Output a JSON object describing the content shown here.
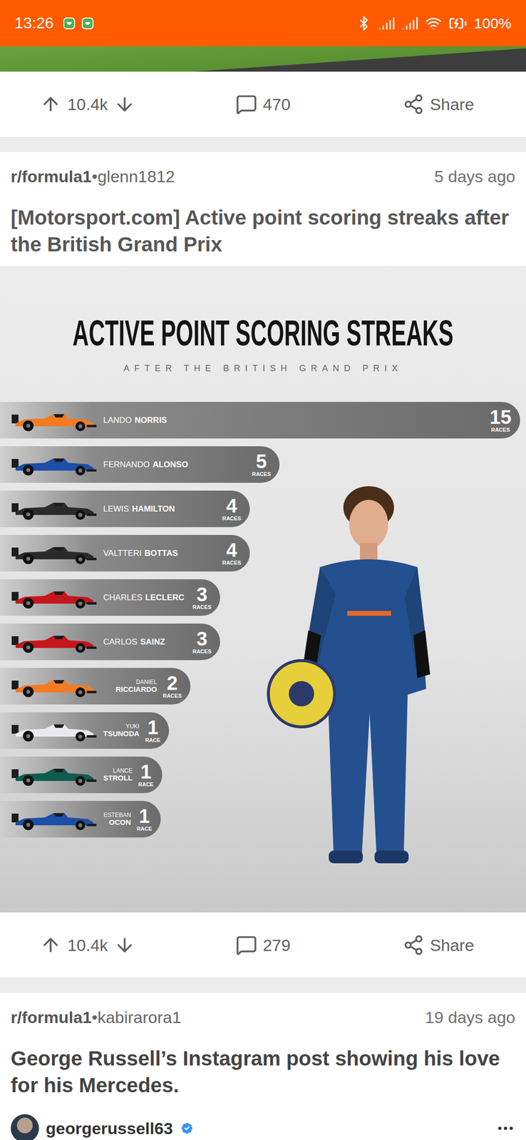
{
  "status_bar": {
    "time": "13:26",
    "battery": "100%",
    "charging": true
  },
  "feed": {
    "previous_post": {
      "actions": {
        "votes": "10.4k",
        "comments": "470",
        "share": "Share"
      }
    },
    "posts": [
      {
        "kind": "image",
        "subreddit": "r/formula1",
        "separator": "•",
        "author": "glenn1812",
        "age": "5 days ago",
        "title": "[Motorsport.com] Active point scoring streaks after the British Grand Prix",
        "chart": {
          "title": "ACTIVE POINT SCORING STREAKS",
          "subtitle": "AFTER THE BRITISH GRAND PRIX",
          "series": [
            {
              "first_name": "LANDO",
              "last_name": "NORRIS",
              "value": 15,
              "reading": "15",
              "unit": "RACES",
              "color": "#f47b20",
              "kind": "inline"
            },
            {
              "first_name": "FERNANDO",
              "last_name": "ALONSO",
              "value": 5,
              "reading": "5",
              "unit": "RACES",
              "color": "#1b4fa8",
              "kind": "inline"
            },
            {
              "first_name": "LEWIS",
              "last_name": "HAMILTON",
              "value": 4,
              "reading": "4",
              "unit": "RACES",
              "color": "#2a2a2a",
              "kind": "inline"
            },
            {
              "first_name": "VALTTERI",
              "last_name": "BOTTAS",
              "value": 4,
              "reading": "4",
              "unit": "RACES",
              "color": "#2a2a2a",
              "kind": "inline"
            },
            {
              "first_name": "CHARLES",
              "last_name": "LECLERC",
              "value": 3,
              "reading": "3",
              "unit": "RACES",
              "color": "#c4161c",
              "kind": "inline"
            },
            {
              "first_name": "CARLOS",
              "last_name": "SAINZ",
              "value": 3,
              "reading": "3",
              "unit": "RACES",
              "color": "#c4161c",
              "kind": "inline"
            },
            {
              "first_name": "DANIEL",
              "last_name": "RICCIARDO",
              "value": 2,
              "reading": "2",
              "unit": "RACES",
              "color": "#f47b20",
              "kind": "stacked"
            },
            {
              "first_name": "YUKI",
              "last_name": "TSUNODA",
              "value": 1,
              "reading": "1",
              "unit": "RACE",
              "color": "#e9eaee",
              "kind": "stacked"
            },
            {
              "first_name": "LANCE",
              "last_name": "STROLL",
              "value": 1,
              "reading": "1",
              "unit": "RACE",
              "color": "#0d5c4e",
              "kind": "stacked"
            },
            {
              "first_name": "ESTEBAN",
              "last_name": "OCON",
              "value": 1,
              "reading": "1",
              "unit": "RACE",
              "color": "#1b4fa8",
              "kind": "stacked"
            }
          ]
        },
        "actions": {
          "votes": "10.4k",
          "comments": "279",
          "share": "Share"
        }
      },
      {
        "kind": "embed",
        "subreddit": "r/formula1",
        "separator": "•",
        "author": "kabirarora1",
        "age": "19 days ago",
        "title": "George Russell’s Instagram post showing his love for his Mercedes.",
        "user": {
          "handle": "georgerussell63",
          "verified": true
        }
      }
    ]
  }
}
